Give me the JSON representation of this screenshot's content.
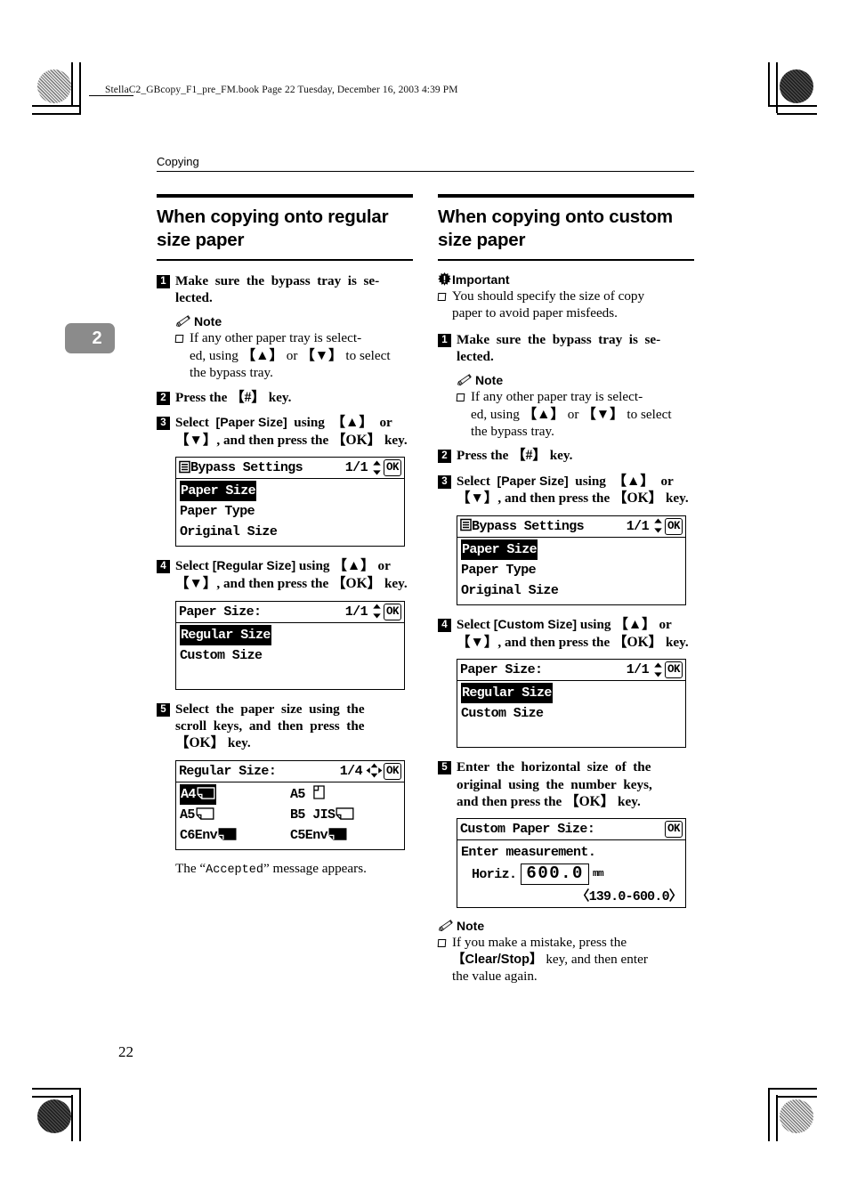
{
  "print_header": {
    "file_info": "StellaC2_GBcopy_F1_pre_FM.book  Page 22  Tuesday, December 16, 2003  4:39 PM"
  },
  "running_head": "Copying",
  "chapter_tab": "2",
  "page_number": "22",
  "left_column": {
    "section_title": "When copying onto regular size paper",
    "steps": [
      {
        "num": "1",
        "text_html": "Make sure the bypass tray is selected."
      },
      {
        "num": "2",
        "text_html": "Press the 【#】 key."
      },
      {
        "num": "3",
        "text_html": "Select [Paper Size] using 【▲】 or 【▼】, and then press the 【OK】 key."
      },
      {
        "num": "4",
        "text_html": "Select [Regular Size] using 【▲】 or 【▼】, and then press the 【OK】 key."
      },
      {
        "num": "5",
        "text_html": "Select the paper size using the scroll keys, and then press the 【OK】 key."
      }
    ],
    "note_label": "Note",
    "note_text": "If any other paper tray is selected, using 【▲】 or 【▼】 to select the bypass tray.",
    "note_text_part1": "If any other paper tray is select-ed, using ",
    "note_text_part2": " or ",
    "note_text_part3": " to select the bypass tray.",
    "after_text_pre": "The “",
    "after_text_mono": "Accepted",
    "after_text_post": "” message appears.",
    "lcd_bypass": {
      "title": "Bypass Settings",
      "page": "1/1",
      "ok": "OK",
      "items": [
        "Paper Size",
        "Paper Type",
        "Original Size"
      ],
      "selected": "Paper Size"
    },
    "lcd_paper_size": {
      "title": "Paper Size:",
      "page": "1/1",
      "ok": "OK",
      "items": [
        "Regular Size",
        "Custom Size"
      ],
      "selected": "Regular Size"
    },
    "lcd_regular_size": {
      "title": "Regular Size:",
      "page": "1/4",
      "ok": "OK",
      "selected": "A4",
      "items": [
        {
          "label": "A4",
          "orient": "land"
        },
        {
          "label": "A5",
          "orient": "port"
        },
        {
          "label": "A5",
          "orient": "land"
        },
        {
          "label": "B5 JIS",
          "orient": "land"
        },
        {
          "label": "C6Env",
          "orient": "land"
        },
        {
          "label": "C5Env",
          "orient": "land"
        }
      ]
    }
  },
  "right_column": {
    "section_title": "When copying onto custom size paper",
    "important_label": "Important",
    "important_text": "You should specify the size of copy paper to avoid paper misfeeds.",
    "note_label": "Note",
    "note_text_part1": "If any other paper tray is select-ed, using ",
    "note_text_part2": " or ",
    "note_text_part3": " to select the bypass tray.",
    "steps": [
      {
        "num": "1",
        "text_html": "Make sure the bypass tray is selected."
      },
      {
        "num": "2",
        "text_html": "Press the 【#】 key."
      },
      {
        "num": "3",
        "text_html": "Select [Paper Size] using 【▲】 or 【▼】, and then press the 【OK】 key."
      },
      {
        "num": "4",
        "text_html": "Select [Custom Size] using 【▲】 or 【▼】, and then press the 【OK】 key."
      },
      {
        "num": "5",
        "text_html": "Enter the horizontal size of the original using the number keys, and then press the 【OK】 key."
      }
    ],
    "lcd_bypass": {
      "title": "Bypass Settings",
      "page": "1/1",
      "ok": "OK",
      "items": [
        "Paper Size",
        "Paper Type",
        "Original Size"
      ],
      "selected": "Paper Size"
    },
    "lcd_paper_size": {
      "title": "Paper Size:",
      "page": "1/1",
      "ok": "OK",
      "items": [
        "Regular Size",
        "Custom Size"
      ],
      "selected": "Regular Size"
    },
    "lcd_custom": {
      "title": "Custom Paper Size:",
      "ok": "OK",
      "prompt": "Enter measurement.",
      "field_label": "Horiz.",
      "value": "600.0",
      "unit": "mm",
      "range": "〈139.0-600.0〉"
    },
    "final_note_label": "Note",
    "final_note_part1": "If you make a mistake, press the ",
    "final_note_key": "【Clear/Stop】",
    "final_note_part2": " key, and then enter the value again."
  },
  "keys": {
    "hash": "【#】",
    "up": "【▲】",
    "down": "【▼】",
    "ok": "【OK】"
  },
  "colors": {
    "chapter_tab_bg": "#8b8b8b",
    "rule": "#000000",
    "text": "#000000"
  }
}
